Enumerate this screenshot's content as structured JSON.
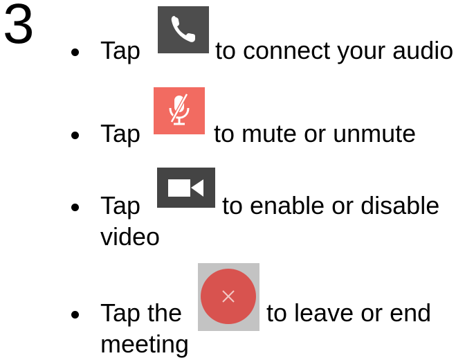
{
  "step": {
    "number": "3"
  },
  "items": [
    {
      "before": "Tap",
      "after": "to connect your audio",
      "icon": "phone-icon",
      "color": "#4d4d4d"
    },
    {
      "before": "Tap",
      "after": "to mute or unmute",
      "icon": "microphone-muted-icon",
      "color": "#f26b61"
    },
    {
      "before": "Tap",
      "after": "to enable or disable",
      "continuation": "video",
      "icon": "video-camera-icon",
      "color": "#444444"
    },
    {
      "before": "Tap the",
      "after": "to leave or end",
      "continuation": "meeting",
      "icon": "close-icon",
      "color": "#d8534f",
      "background": "#c3c3c3"
    }
  ]
}
